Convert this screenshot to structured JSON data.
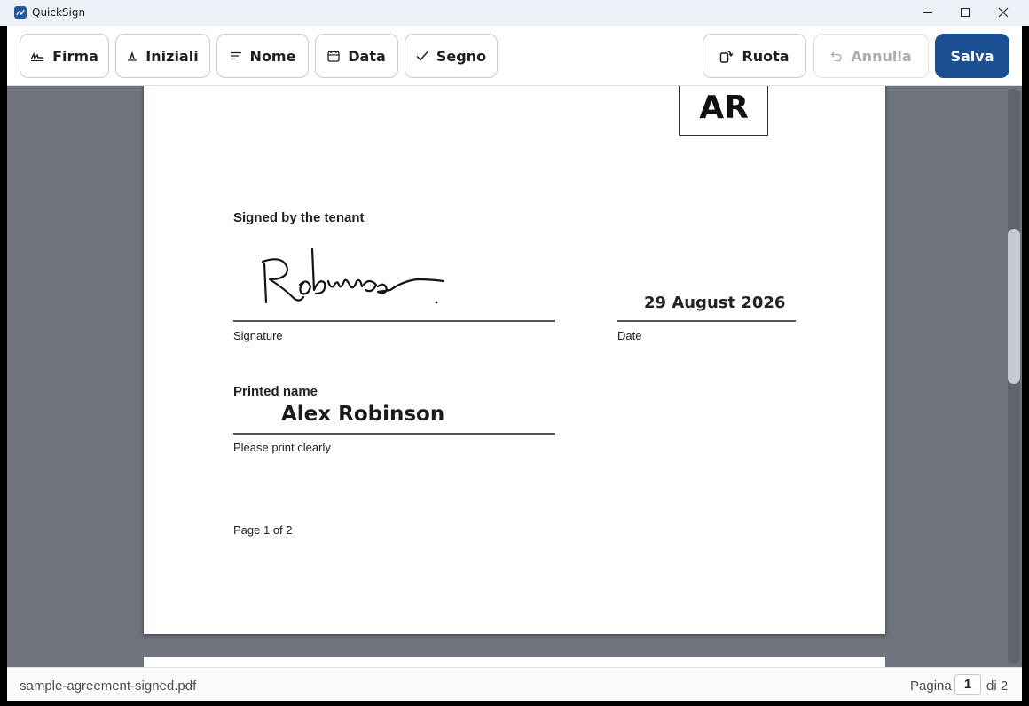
{
  "window": {
    "title": "QuickSign"
  },
  "toolbar": {
    "tools": [
      {
        "label": "Firma",
        "icon": "signature-icon"
      },
      {
        "label": "Iniziali",
        "icon": "initials-icon"
      },
      {
        "label": "Nome",
        "icon": "text-lines-icon"
      },
      {
        "label": "Data",
        "icon": "calendar-icon"
      },
      {
        "label": "Segno",
        "icon": "checkmark-icon"
      }
    ],
    "rotate_label": "Ruota",
    "undo_label": "Annulla",
    "undo_disabled": true,
    "save_label": "Salva",
    "accent_color": "#1b4f94"
  },
  "document": {
    "initials": "AR",
    "signed_heading": "Signed by the tenant",
    "signature_caption": "Signature",
    "date_value": "29 August 2026",
    "date_caption": "Date",
    "printed_name_heading": "Printed name",
    "printed_name_value": "Alex Robinson",
    "printed_name_caption": "Please print clearly",
    "page_footer": "Page 1 of 2"
  },
  "status": {
    "filename": "sample-agreement-signed.pdf",
    "page_label": "Pagina",
    "current_page": "1",
    "total_label": "di 2"
  }
}
